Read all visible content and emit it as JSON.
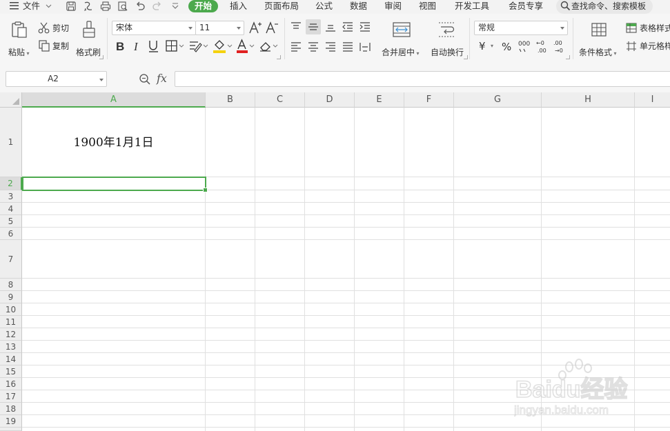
{
  "menubar": {
    "file_label": "文件",
    "tabs": [
      {
        "label": "开始",
        "active": true
      },
      {
        "label": "插入"
      },
      {
        "label": "页面布局"
      },
      {
        "label": "公式"
      },
      {
        "label": "数据"
      },
      {
        "label": "审阅"
      },
      {
        "label": "视图"
      },
      {
        "label": "开发工具"
      },
      {
        "label": "会员专享"
      }
    ],
    "search_text": "查找命令、搜索模板",
    "accent_color": "#4ca94d"
  },
  "ribbon": {
    "paste": "粘贴",
    "cut": "剪切",
    "copy": "复制",
    "format_painter": "格式刷",
    "font_name": "宋体",
    "font_size": "11",
    "merge_center": "合并居中",
    "wrap_text": "自动换行",
    "number_format": "常规",
    "conditional_format": "条件格式",
    "table_style": "表格样式",
    "cell_style": "单元格样",
    "percent_symbol": "%",
    "currency_symbol": "¥"
  },
  "formula_bar": {
    "name_box": "A2",
    "fx": "fx",
    "formula_value": ""
  },
  "sheet": {
    "columns": [
      "A",
      "B",
      "C",
      "D",
      "E",
      "F",
      "G",
      "H",
      "I"
    ],
    "selected_column": "A",
    "rows": [
      "1",
      "2",
      "3",
      "4",
      "5",
      "6",
      "7",
      "8",
      "9",
      "10",
      "11",
      "12",
      "13",
      "14",
      "15",
      "16",
      "17",
      "18",
      "19"
    ],
    "selected_row": "2",
    "cell_A1": "1900年1月1日",
    "active_cell": "A2"
  },
  "watermark": {
    "brand_text": "Baidu经验",
    "url_text": "jingyan.baidu.com"
  }
}
